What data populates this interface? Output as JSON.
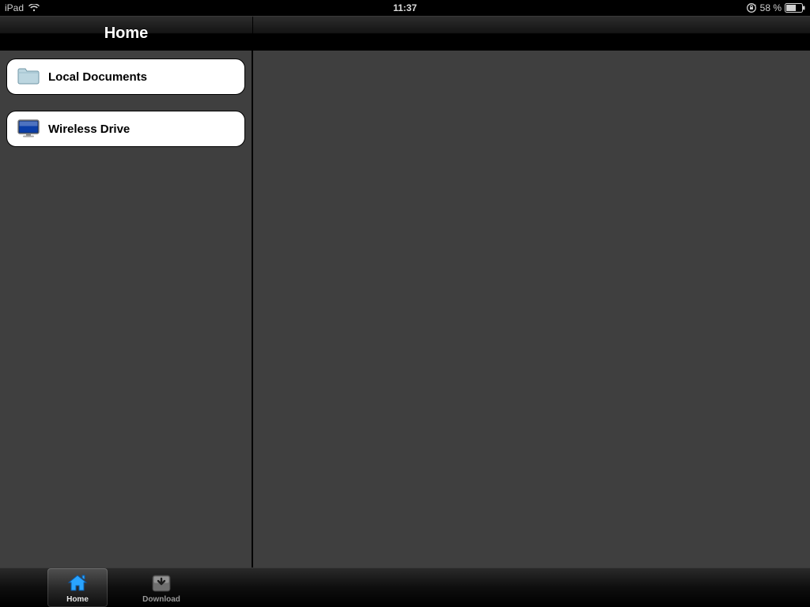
{
  "status_bar": {
    "device": "iPad",
    "time": "11:37",
    "battery_text": "58 %"
  },
  "nav": {
    "title": "Home"
  },
  "sidebar": {
    "items": [
      {
        "icon": "folder-icon",
        "label": "Local Documents"
      },
      {
        "icon": "monitor-icon",
        "label": "Wireless Drive"
      }
    ]
  },
  "tabs": [
    {
      "icon": "home-icon",
      "label": "Home",
      "selected": true
    },
    {
      "icon": "download-icon",
      "label": "Download",
      "selected": false
    }
  ]
}
